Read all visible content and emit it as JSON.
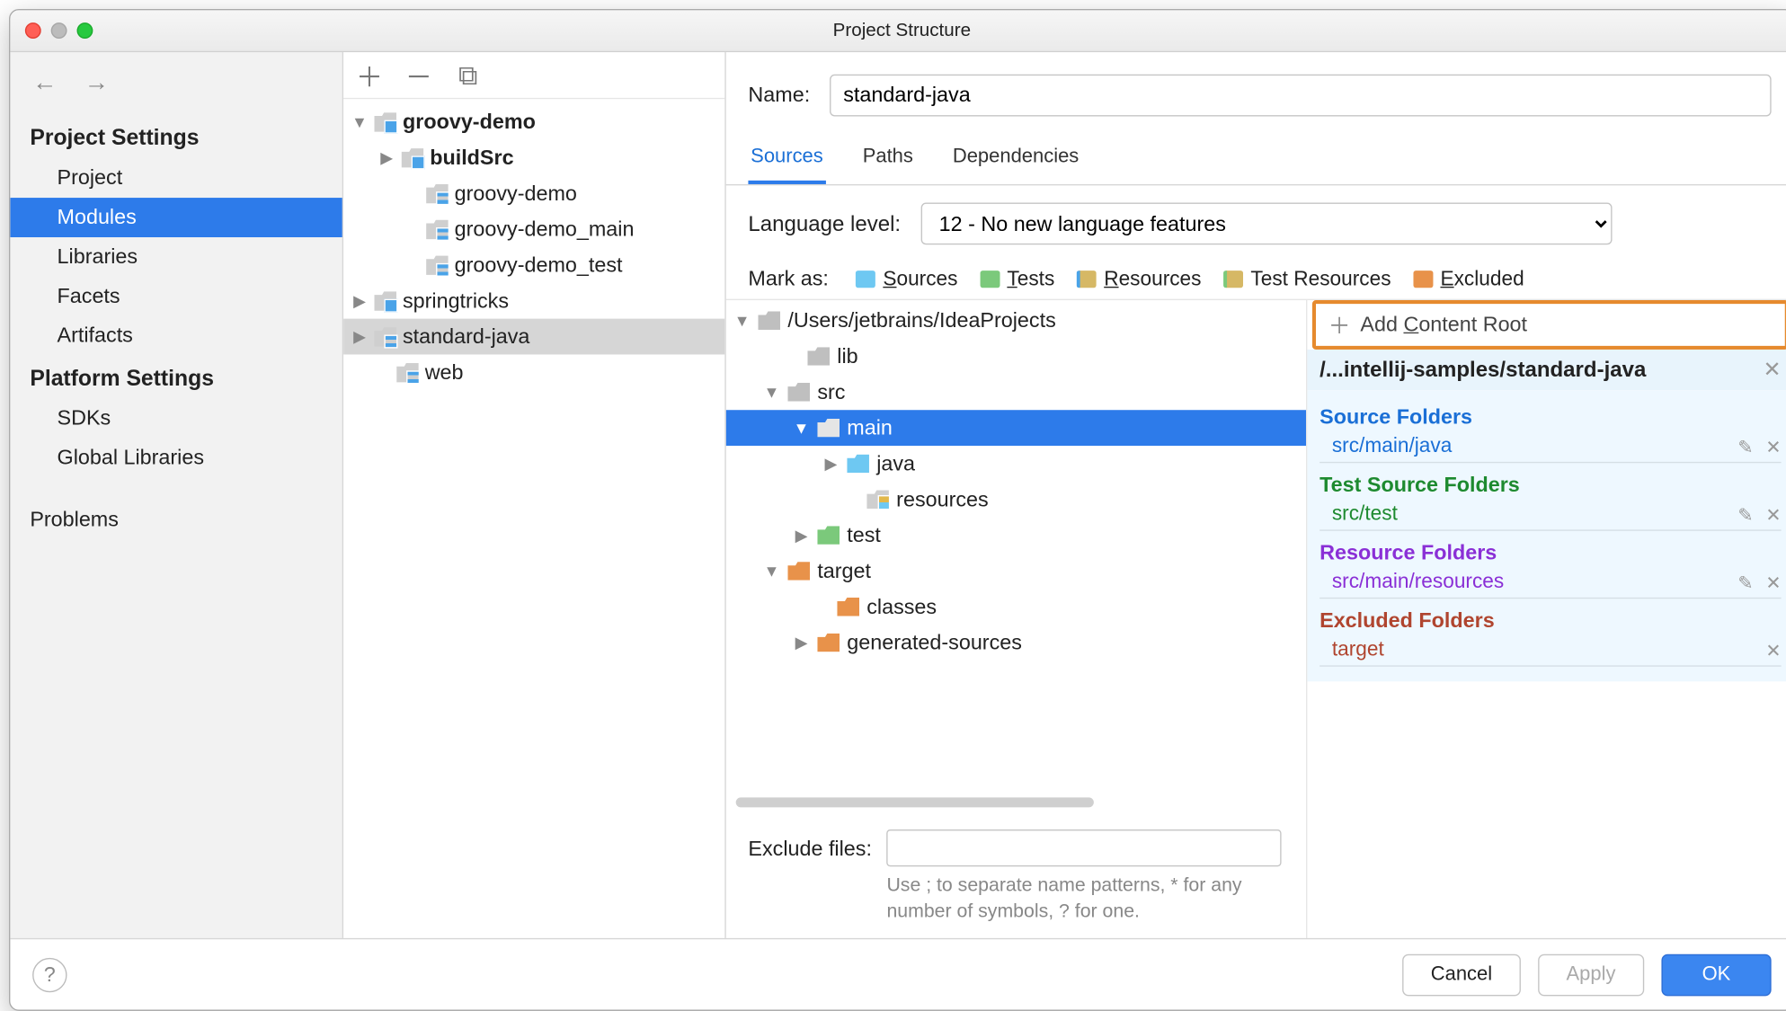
{
  "window": {
    "title": "Project Structure"
  },
  "nav": {
    "sections": {
      "project_settings": "Project Settings",
      "platform_settings": "Platform Settings"
    },
    "items": {
      "project": "Project",
      "modules": "Modules",
      "libraries": "Libraries",
      "facets": "Facets",
      "artifacts": "Artifacts",
      "sdks": "SDKs",
      "global_libraries": "Global Libraries",
      "problems": "Problems"
    }
  },
  "modules_tree": {
    "groovy_demo": "groovy-demo",
    "buildSrc": "buildSrc",
    "groovy_demo_mod": "groovy-demo",
    "groovy_demo_main": "groovy-demo_main",
    "groovy_demo_test": "groovy-demo_test",
    "springtricks": "springtricks",
    "standard_java": "standard-java",
    "web": "web"
  },
  "module": {
    "name_label": "Name:",
    "name_value": "standard-java",
    "tabs": {
      "sources": "Sources",
      "paths": "Paths",
      "dependencies": "Dependencies"
    },
    "lang_level_label": "Language level:",
    "lang_level_value": "12 - No new language features",
    "mark_as_label": "Mark as:",
    "marks": {
      "sources": "Sources",
      "tests": "Tests",
      "resources": "Resources",
      "test_resources": "Test Resources",
      "excluded": "Excluded"
    },
    "dir_root": "/Users/jetbrains/IdeaProjects",
    "dirs": {
      "lib": "lib",
      "src": "src",
      "main": "main",
      "java": "java",
      "resources": "resources",
      "test": "test",
      "target": "target",
      "classes": "classes",
      "generated_sources": "generated-sources"
    },
    "exclude_files_label": "Exclude files:",
    "exclude_hint": "Use ; to separate name patterns, * for any number of symbols, ? for one."
  },
  "content_roots": {
    "add_label": "Add Content Root",
    "root_path": "/...intellij-samples/standard-java",
    "sections": {
      "source_folders": "Source Folders",
      "test_source_folders": "Test Source Folders",
      "resource_folders": "Resource Folders",
      "excluded_folders": "Excluded Folders"
    },
    "items": {
      "src_main_java": "src/main/java",
      "src_test": "src/test",
      "src_main_resources": "src/main/resources",
      "target": "target"
    }
  },
  "footer": {
    "cancel": "Cancel",
    "apply": "Apply",
    "ok": "OK"
  }
}
